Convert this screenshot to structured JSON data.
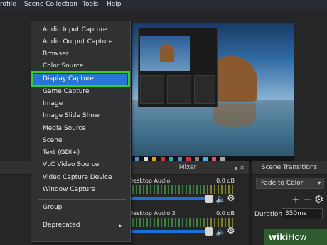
{
  "menubar": {
    "items": [
      "rofile",
      "Scene Collection",
      "Tools",
      "Help"
    ]
  },
  "context_menu": {
    "items": [
      "Audio Input Capture",
      "Audio Output Capture",
      "Browser",
      "Color Source",
      "Display Capture",
      "Game Capture",
      "Image",
      "Image Slide Show",
      "Media Source",
      "Scene",
      "Text (GDI+)",
      "VLC Video Source",
      "Video Capture Device",
      "Window Capture"
    ],
    "selected_index": 4,
    "highlight_color": "#38cd2e",
    "selected_bg": "#2576d8",
    "group_label": "Group",
    "deprecated_label": "Deprecated",
    "deprecated_arrow": "▸"
  },
  "mixer": {
    "title": "Mixer",
    "channels": [
      {
        "label": "Desktop Audio",
        "db": "0.0 dB",
        "volume_fraction": 0.75
      },
      {
        "label": "Desktop Audio 2",
        "db": "0.0 dB",
        "volume_fraction": 0.75
      }
    ]
  },
  "transitions": {
    "title": "Scene Transitions",
    "selected": "Fade to Color",
    "add_label": "+",
    "remove_label": "−",
    "settings_label": "⚙",
    "duration_label": "Duration",
    "duration_value": "350ms"
  },
  "icons": {
    "speaker": "speaker-icon",
    "gear": "gear-icon",
    "float": "float-icon",
    "close": "close-icon"
  },
  "watermark": {
    "part1": "wiki",
    "part2": "How"
  }
}
